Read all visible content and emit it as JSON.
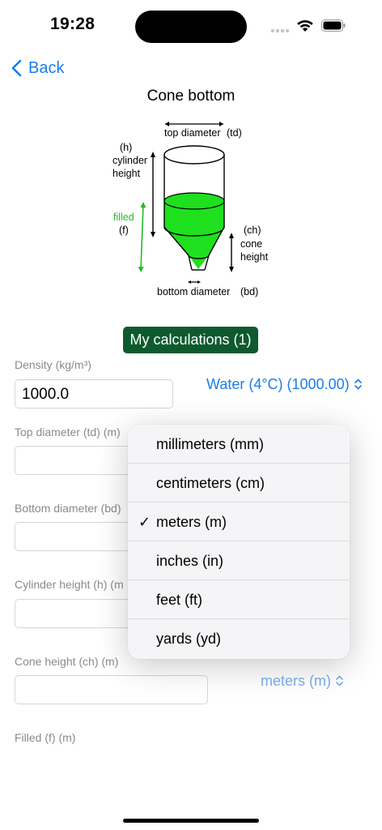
{
  "status": {
    "time": "19:28"
  },
  "nav": {
    "back_label": "Back"
  },
  "page": {
    "title": "Cone bottom"
  },
  "diagram": {
    "top_diameter": "top diameter",
    "td": "(td)",
    "h": "(h)",
    "cylinder": "cylinder",
    "height": "height",
    "filled": "filled",
    "f": "(f)",
    "ch": "(ch)",
    "cone": "cone",
    "cone_height": "height",
    "bottom_diameter": "bottom diameter",
    "bd": "(bd)",
    "fill_color": "#1fe01f"
  },
  "calculations_button": "My calculations (1)",
  "form": {
    "density_label": "Density (kg/m³)",
    "density_value": "1000.0",
    "density_picker": "Water (4°C) (1000.00)",
    "top_diameter_label": "Top diameter (td) (m)",
    "bottom_diameter_label": "Bottom diameter (bd)",
    "cylinder_height_label": "Cylinder height (h) (m",
    "cone_height_label": "Cone height (ch) (m)",
    "cone_height_picker": "meters (m)",
    "filled_label": "Filled (f) (m)"
  },
  "unit_menu": {
    "items": [
      "millimeters (mm)",
      "centimeters (cm)",
      "meters (m)",
      "inches (in)",
      "feet (ft)",
      "yards (yd)"
    ],
    "selected_index": 2,
    "check": "✓"
  },
  "colors": {
    "accent": "#1a7ee8",
    "button_bg": "#0e5a2f",
    "fill_green": "#1fe01f",
    "label_gray": "#8a8a8e"
  }
}
